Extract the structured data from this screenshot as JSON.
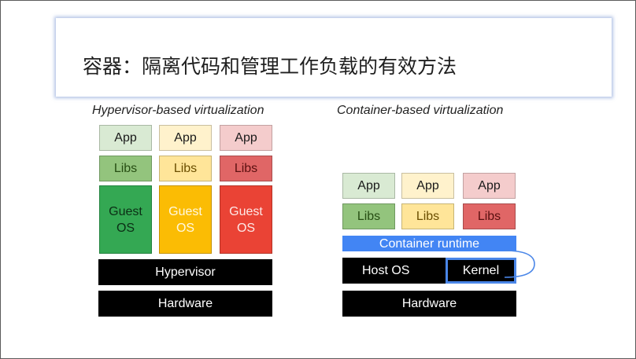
{
  "slide": {
    "title": "容器：隔离代码和管理工作负载的有效方法"
  },
  "hypervisor_diagram": {
    "caption": "Hypervisor-based virtualization",
    "apps": [
      "App",
      "App",
      "App"
    ],
    "libs": [
      "Libs",
      "Libs",
      "Libs"
    ],
    "guest_os": [
      "Guest\nOS",
      "Guest\nOS",
      "Guest\nOS"
    ],
    "hypervisor_label": "Hypervisor",
    "hardware_label": "Hardware"
  },
  "container_diagram": {
    "caption": "Container-based virtualization",
    "apps": [
      "App",
      "App",
      "App"
    ],
    "libs": [
      "Libs",
      "Libs",
      "Libs"
    ],
    "runtime_label": "Container runtime",
    "host_os_label": "Host OS",
    "kernel_label": "Kernel",
    "hardware_label": "Hardware"
  },
  "colors": {
    "green": "#34a853",
    "yellow": "#fbbc04",
    "red": "#ea4335",
    "blue": "#4285f4",
    "black": "#000000"
  }
}
